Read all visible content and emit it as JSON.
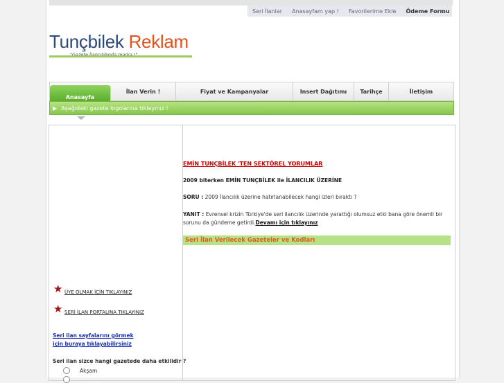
{
  "top_links": [
    "Seri İlanlar",
    "Anasayfam yap !",
    "Favorilerime Ekle",
    "Ödeme Formu"
  ],
  "logo": {
    "part1": "Tunçbilek",
    "part2": "Reklam",
    "slogan": "\"Gazete İlancılığında marka !\""
  },
  "nav": {
    "items": [
      "Anasayfa",
      "İlan Verin !",
      "Fiyat ve Kampanyalar",
      "Insert Dağıtımı",
      "Tarihçe",
      "İletişim"
    ]
  },
  "banner": {
    "text": "Aşağıdaki gazete logolarına tıklayınız !"
  },
  "main": {
    "headline": "EMİN TUNÇBİLEK 'TEN SEKTÖREL YORUMLAR",
    "subtitle": "2009 biterken EMİN TUNÇBİLEK ile İLANCILIK ÜZERİNE",
    "q_label": "SORU :",
    "q_text": " 2009 İlancılık üzerine hatırlanabilecek hangi izleri bıraktı ?",
    "a_label": "YANIT :",
    "a_text1": " Evrensel krizin Türkiye'de seri ilancılık üzerinde yarattığı olumsuz etki bana göre önemli bir",
    "a_text2": "sorunu da gündeme getirdi.",
    "more": "Devamı için tıklayınız",
    "section_title": "Seri İlan Verilecek Gazeteler ve Kodları"
  },
  "sidebar": {
    "member_link": "ÜYE OLMAK İÇİN TIKLAYINIZ",
    "portal_link": "SERİ İLAN PORTALINA TIKLAYINIZ",
    "pages_line1": "Seri ilan sayfalarını görmek",
    "pages_line2": "için buraya tıklayabilirsiniz",
    "poll_question": "Seri ilan sizce hangi gazetede daha etkilidir ?",
    "poll_options": [
      "Akşam"
    ]
  }
}
